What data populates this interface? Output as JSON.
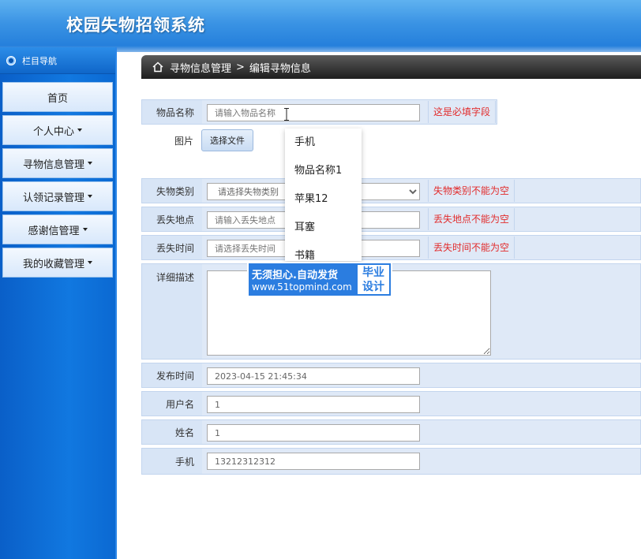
{
  "app": {
    "title": "校园失物招领系统"
  },
  "sidebar": {
    "header": "栏目导航",
    "items": [
      {
        "label": "首页",
        "has_caret": false
      },
      {
        "label": "个人中心",
        "has_caret": true
      },
      {
        "label": "寻物信息管理",
        "has_caret": true
      },
      {
        "label": "认领记录管理",
        "has_caret": true
      },
      {
        "label": "感谢信管理",
        "has_caret": true
      },
      {
        "label": "我的收藏管理",
        "has_caret": true
      }
    ]
  },
  "breadcrumb": {
    "section": "寻物信息管理",
    "separator": ">",
    "page": "编辑寻物信息"
  },
  "form": {
    "item_name": {
      "label": "物品名称",
      "placeholder": "请输入物品名称",
      "error": "这是必填字段"
    },
    "picture": {
      "label": "图片",
      "button": "选择文件"
    },
    "category": {
      "label": "失物类别",
      "placeholder": "请选择失物类别",
      "error": "失物类别不能为空"
    },
    "location": {
      "label": "丢失地点",
      "placeholder": "请输入丢失地点",
      "error": "丢失地点不能为空"
    },
    "lost_time": {
      "label": "丢失时间",
      "placeholder": "请选择丢失时间",
      "error": "丢失时间不能为空"
    },
    "description": {
      "label": "详细描述"
    },
    "publish_time": {
      "label": "发布时间",
      "value": "2023-04-15 21:45:34"
    },
    "username": {
      "label": "用户名",
      "value": "1"
    },
    "name": {
      "label": "姓名",
      "value": "1"
    },
    "phone": {
      "label": "手机",
      "value": "13212312312"
    }
  },
  "autocomplete": {
    "options": [
      "手机",
      "物品名称1",
      "苹果12",
      "耳塞",
      "书籍"
    ]
  },
  "watermark": {
    "line1": "无须担心.自动发货",
    "line2": "www.51topmind.com",
    "badge1": "毕业",
    "badge2": "设计"
  },
  "colors": {
    "header": "#3a93e4",
    "sidebar": "#1178e0",
    "error": "#e22c2c",
    "row_bg": "#dfe9f7"
  }
}
